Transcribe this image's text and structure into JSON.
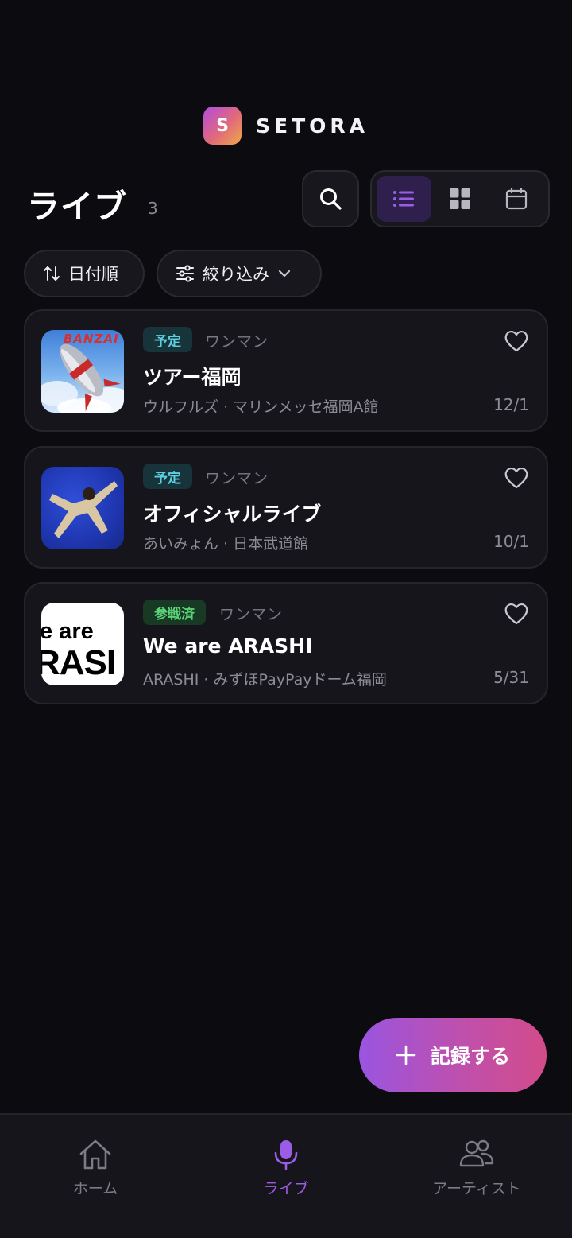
{
  "app": {
    "logo_letter": "S",
    "name": "SETORA"
  },
  "header": {
    "title": "ライブ",
    "count": "3"
  },
  "toolbar": {
    "search_icon": "search-icon",
    "views": [
      {
        "name": "list-view",
        "icon": "list-icon",
        "active": true
      },
      {
        "name": "grid-view",
        "icon": "grid-icon",
        "active": false
      },
      {
        "name": "calendar-view",
        "icon": "calendar-icon",
        "active": false
      }
    ]
  },
  "filters": {
    "sort_label": "日付順",
    "filter_label": "絞り込み"
  },
  "lives": [
    {
      "status": "予定",
      "status_type": "scheduled",
      "type": "ワンマン",
      "title": "ツアー福岡",
      "subtitle": "ウルフルズ · マリンメッセ福岡A館",
      "date": "12/1",
      "thumb_text": "BANZAI"
    },
    {
      "status": "予定",
      "status_type": "scheduled",
      "type": "ワンマン",
      "title": "オフィシャルライブ",
      "subtitle": "あいみょん · 日本武道館",
      "date": "10/1"
    },
    {
      "status": "参戦済",
      "status_type": "attended",
      "type": "ワンマン",
      "title": "We are ARASHI",
      "subtitle": "ARASHI · みずほPayPayドーム福岡",
      "date": "5/31",
      "thumb_text_1": "e are",
      "thumb_text_2": "RASI"
    }
  ],
  "fab": {
    "label": "記録する"
  },
  "nav": {
    "home": "ホーム",
    "live": "ライブ",
    "artist": "アーティスト"
  },
  "colors": {
    "background": "#0c0b10",
    "accent": "#9b5de5",
    "scheduled": "#5ccfe0",
    "attended": "#5cd47a"
  }
}
